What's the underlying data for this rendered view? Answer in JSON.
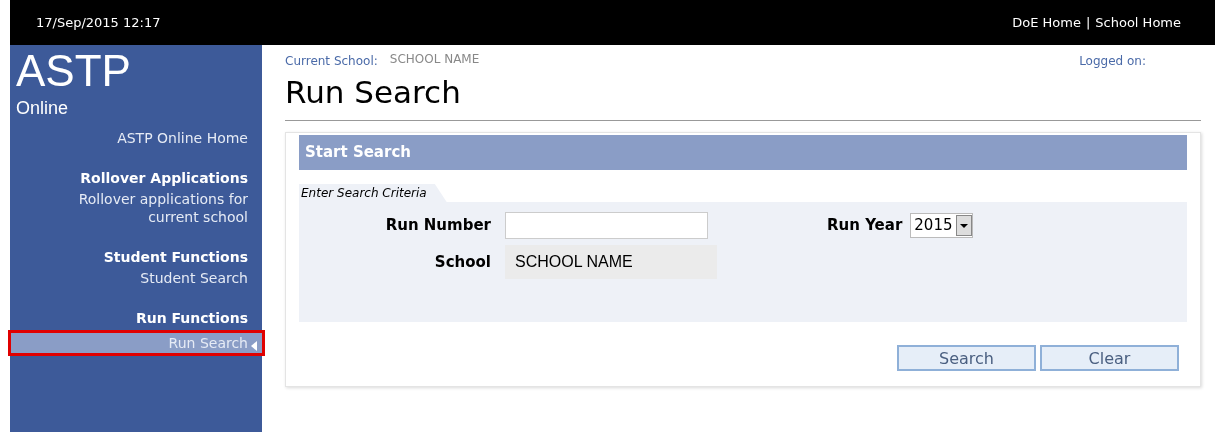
{
  "top_bar": {
    "datetime": "17/Sep/2015 12:17",
    "links": [
      "DoE Home",
      "School Home"
    ],
    "separator": "|"
  },
  "sidebar": {
    "logo": "ASTP",
    "subtitle": "Online",
    "items": [
      {
        "kind": "link",
        "label": "ASTP Online Home",
        "selected": false
      },
      {
        "kind": "heading",
        "label": "Rollover Applications"
      },
      {
        "kind": "link",
        "label": "Rollover applications for current school",
        "selected": false
      },
      {
        "kind": "heading",
        "label": "Student Functions"
      },
      {
        "kind": "link",
        "label": "Student Search",
        "selected": false
      },
      {
        "kind": "heading",
        "label": "Run Functions"
      },
      {
        "kind": "link",
        "label": "Run Search",
        "selected": true
      }
    ]
  },
  "header": {
    "current_school_label": "Current School:",
    "current_school": "SCHOOL NAME",
    "logged_on_label": "Logged on:",
    "title": "Run Search"
  },
  "panel": {
    "title": "Start Search",
    "criteria_tab": "Enter Search Criteria",
    "run_number": {
      "label": "Run Number"
    },
    "school": {
      "label": "School",
      "value": "SCHOOL NAME"
    },
    "run_year": {
      "label": "Run Year",
      "value": "2015"
    },
    "buttons": [
      "Search",
      "Clear"
    ]
  }
}
